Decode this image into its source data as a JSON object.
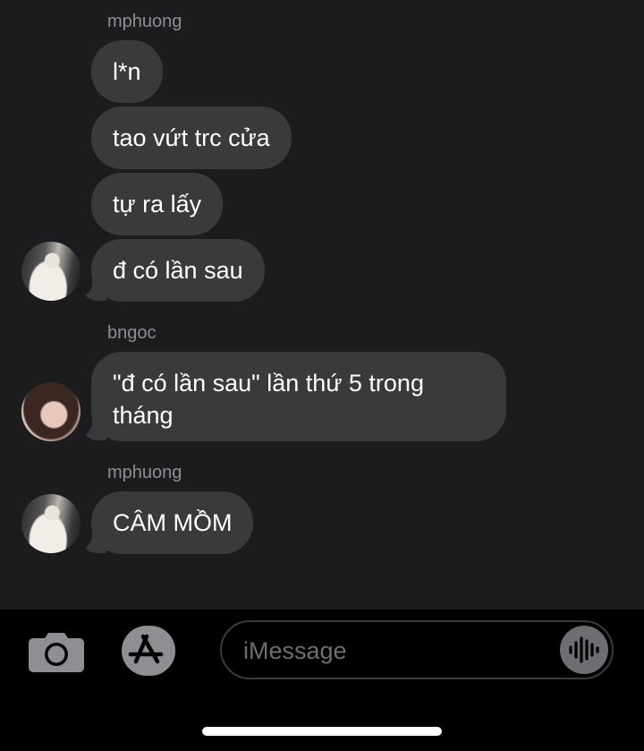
{
  "thread": {
    "groups": [
      {
        "sender": "mphuong",
        "messages": [
          "l*n",
          "tao vứt trc cửa",
          "tự ra lấy",
          "đ có lần sau"
        ]
      },
      {
        "sender": "bngoc",
        "messages": [
          "\"đ có lần sau\" lần thứ 5 trong tháng"
        ]
      },
      {
        "sender": "mphuong",
        "messages": [
          "CÂM MỒM"
        ]
      }
    ]
  },
  "compose": {
    "placeholder": "iMessage"
  },
  "colors": {
    "background": "#1c1c1e",
    "bubble": "#3a3a3c",
    "sender_name": "#8e8e93",
    "compose_bar": "#000000"
  },
  "icons": {
    "camera": "camera-icon",
    "apps": "app-store-icon",
    "dictation": "waveform-icon"
  }
}
